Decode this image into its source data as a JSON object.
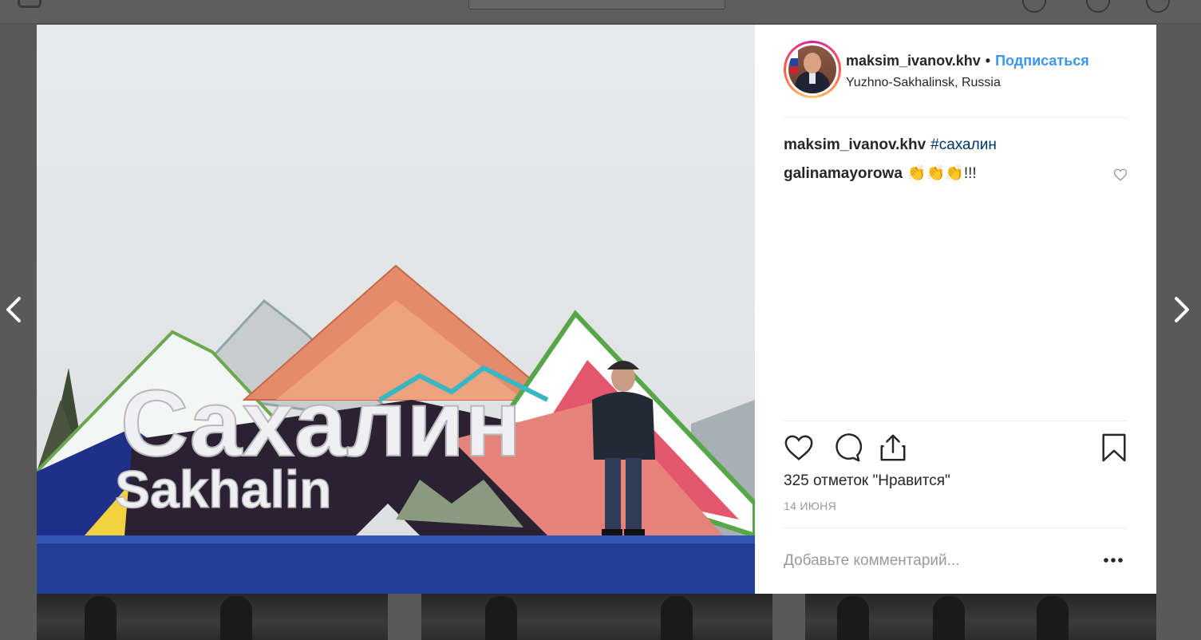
{
  "post": {
    "username": "maksim_ivanov.khv",
    "separator": "•",
    "follow_label": "Подписаться",
    "location": "Yuzhno-Sakhalinsk, Russia"
  },
  "comments": [
    {
      "user": "maksim_ivanov.khv",
      "text": "#сахалин",
      "is_tag": true
    },
    {
      "user": "galinamayorowa",
      "text": "👏👏👏!!!",
      "is_tag": false
    }
  ],
  "stats": {
    "likes": "325 отметок \"Нравится\"",
    "date": "14 ИЮНЯ"
  },
  "comment_input": {
    "placeholder": "Добавьте комментарий..."
  },
  "photo": {
    "sign_main": "Сахалин",
    "sign_sub": "Sakhalin"
  },
  "colors": {
    "follow": "#3897f0",
    "hashtag": "#003569",
    "text": "#262626",
    "muted": "#999999"
  },
  "icons": {
    "prev": "chevron-left-icon",
    "next": "chevron-right-icon",
    "like": "heart-icon",
    "comment": "speech-bubble-icon",
    "share": "share-icon",
    "save": "bookmark-icon",
    "more": "more-dots-icon"
  }
}
